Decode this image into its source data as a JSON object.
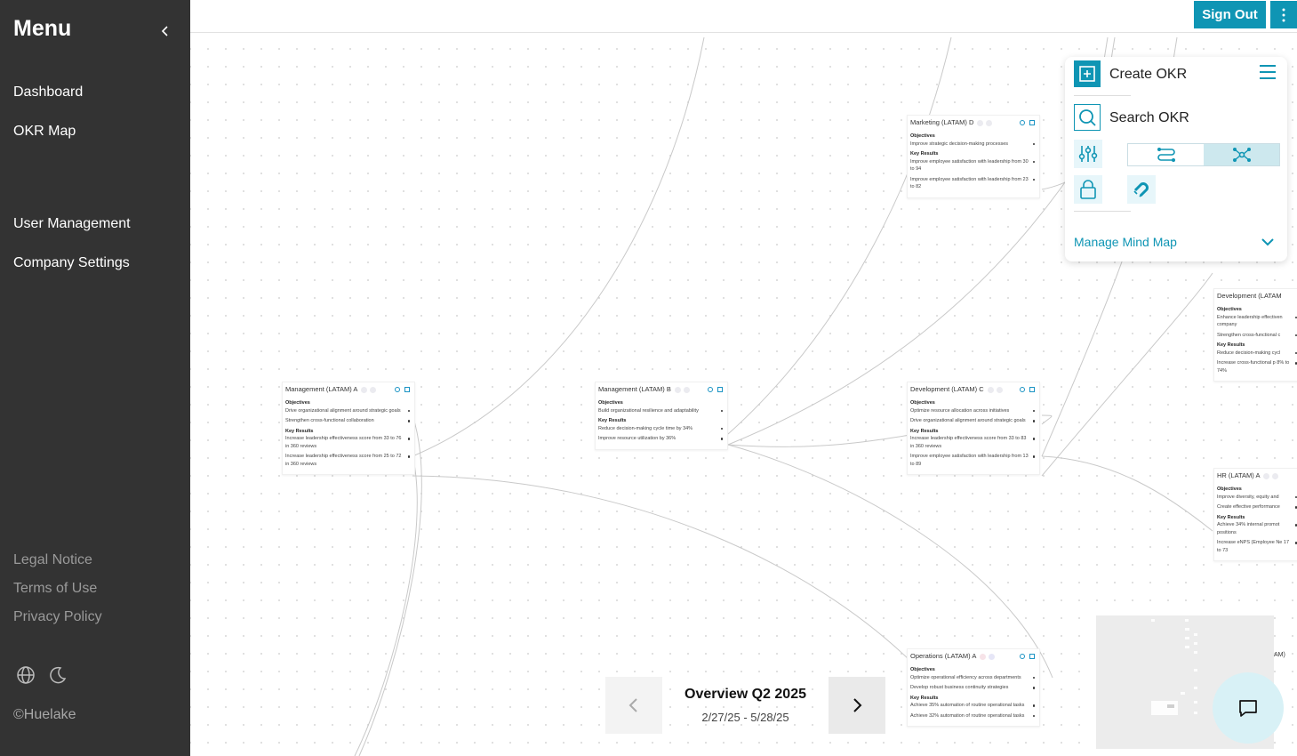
{
  "sidebar": {
    "title": "Menu",
    "nav": [
      {
        "label": "Dashboard"
      },
      {
        "label": "OKR Map"
      },
      {
        "label": "User Management"
      },
      {
        "label": "Company Settings"
      }
    ],
    "footer_links": [
      {
        "label": "Legal Notice"
      },
      {
        "label": "Terms of Use"
      },
      {
        "label": "Privacy Policy"
      }
    ],
    "icons": [
      "globe-icon",
      "moon-icon",
      "chevron-left-icon"
    ],
    "copyright": "©Huelake"
  },
  "header": {
    "signout_label": "Sign Out",
    "accent_color": "#0f95b4"
  },
  "panel": {
    "create_label": "Create OKR",
    "search_label": "Search OKR",
    "manage_label": "Manage Mind Map",
    "icons": [
      "plus-square-icon",
      "search-icon",
      "hamburger-icon",
      "sliders-icon",
      "route-icon",
      "branch-icon",
      "lock-icon",
      "magnet-icon",
      "chevron-down-icon"
    ]
  },
  "cards": [
    {
      "title": "Management (LATAM) A",
      "objectives_label": "Objectives",
      "objectives": [
        "Drive organizational alignment around strategic goals",
        "Strengthen cross-functional collaboration"
      ],
      "kr_label": "Key Results",
      "key_results": [
        "Increase leadership effectiveness score from 33 to 76 in 360 reviews",
        "Increase leadership effectiveness score from 25 to 72 in 360 reviews"
      ]
    },
    {
      "title": "Management (LATAM) B",
      "objectives_label": "Objectives",
      "objectives": [
        "Build organizational resilience and adaptability"
      ],
      "kr_label": "Key Results",
      "key_results": [
        "Reduce decision-making cycle time by 34%",
        "Improve resource utilization by 36%"
      ]
    },
    {
      "title": "Marketing (LATAM) D",
      "objectives_label": "Objectives",
      "objectives": [
        "Improve strategic decision-making processes"
      ],
      "kr_label": "Key Results",
      "key_results": [
        "Improve employee satisfaction with leadership from 30 to 94",
        "Improve employee satisfaction with leadership from 23 to 82"
      ]
    },
    {
      "title": "Development (LATAM) C",
      "objectives_label": "Objectives",
      "objectives": [
        "Optimize resource allocation across initiatives",
        "Drive organizational alignment around strategic goals"
      ],
      "kr_label": "Key Results",
      "key_results": [
        "Increase leadership effectiveness score from 33 to 83 in 360 reviews",
        "Improve employee satisfaction with leadership from 13 to 89"
      ]
    },
    {
      "title": "Operations (LATAM) A",
      "objectives_label": "Objectives",
      "objectives": [
        "Optimize operational efficiency across departments",
        "Develop robust business continuity strategies"
      ],
      "kr_label": "Key Results",
      "key_results": [
        "Achieve 35% automation of routine operational tasks",
        "Achieve 32% automation of routine operational tasks"
      ]
    },
    {
      "title": "Development (LATAM",
      "objectives_label": "Objectives",
      "objectives": [
        "Enhance leadership effectiven company",
        "Strengthen cross-functional c"
      ],
      "kr_label": "Key Results",
      "key_results": [
        "Reduce decision-making cycl",
        "Increase cross-functional p 8% to 74%"
      ]
    },
    {
      "title": "HR (LATAM) A",
      "objectives_label": "Objectives",
      "objectives": [
        "Improve diversity, equity and",
        "Create effective performance"
      ],
      "kr_label": "Key Results",
      "key_results": [
        "Achieve 34% internal promot positions",
        "Increase eNPS (Employee Ne 17 to 73"
      ]
    }
  ],
  "period": {
    "title": "Overview Q2 2025",
    "range": "2/27/25 - 5/28/25"
  },
  "minimap_edge_text": "AM)"
}
